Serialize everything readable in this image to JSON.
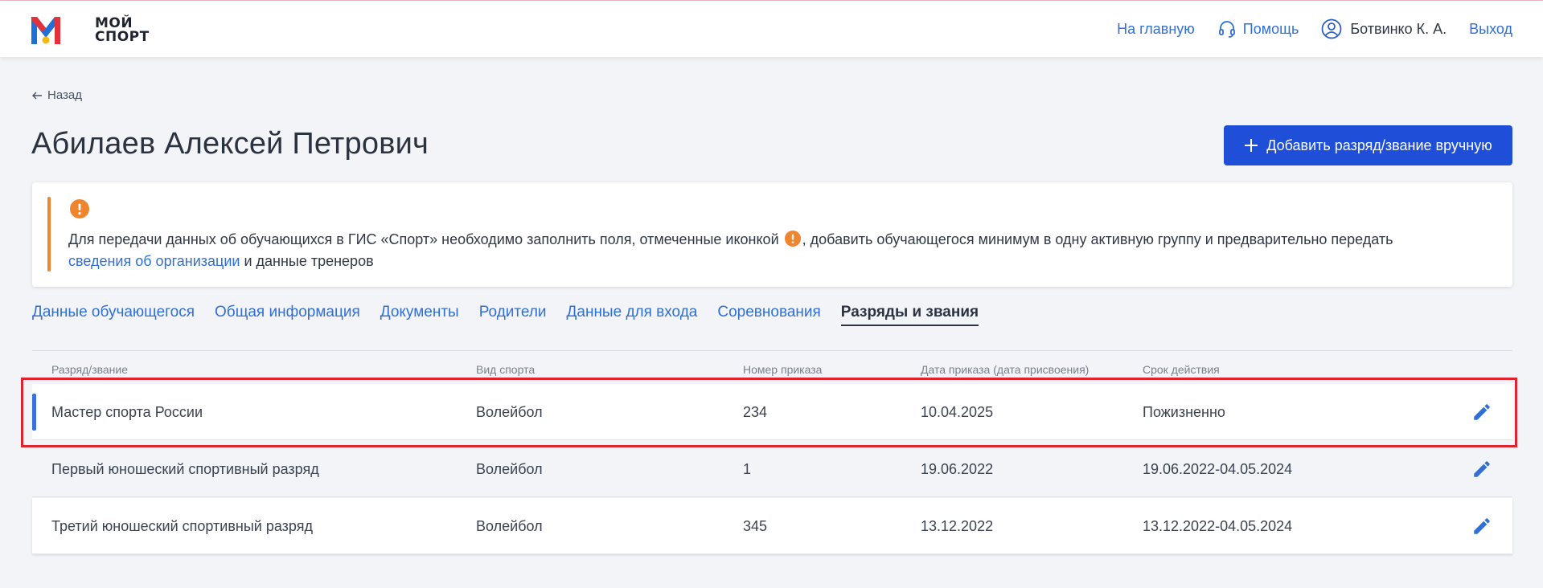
{
  "app": {
    "logo_line1": "МОЙ",
    "logo_line2": "СПОРТ",
    "brand_colors": {
      "red": "#e4323c",
      "blue": "#1f6fd6",
      "yellow": "#f2b90f"
    }
  },
  "nav": {
    "home": "На главную",
    "help": "Помощь",
    "user": "Ботвинко К. А.",
    "logout": "Выход"
  },
  "back_label": "Назад",
  "page_title": "Абилаев Алексей Петрович",
  "add_button_label": "Добавить разряд/звание вручную",
  "notice": {
    "text_before": "Для передачи данных об обучающихся в ГИС «Спорт» необходимо заполнить поля, отмеченные иконкой",
    "text_middle": ", добавить обучающегося минимум в одну активную группу и предварительно передать",
    "link": "сведения об организации",
    "text_after": " и данные тренеров",
    "accent_color": "#f0852f"
  },
  "tabs": [
    {
      "label": "Данные обучающегося",
      "active": false
    },
    {
      "label": "Общая информация",
      "active": false
    },
    {
      "label": "Документы",
      "active": false
    },
    {
      "label": "Родители",
      "active": false
    },
    {
      "label": "Данные для входа",
      "active": false
    },
    {
      "label": "Соревнования",
      "active": false
    },
    {
      "label": "Разряды и звания",
      "active": true
    }
  ],
  "table": {
    "columns": [
      "Разряд/звание",
      "Вид спорта",
      "Номер приказа",
      "Дата приказа (дата присвоения)",
      "Срок действия"
    ],
    "rows": [
      {
        "rank": "Мастер спорта России",
        "sport": "Волейбол",
        "order": "234",
        "date": "10.04.2025",
        "validity": "Пожизненно"
      },
      {
        "rank": "Первый юношеский спортивный разряд",
        "sport": "Волейбол",
        "order": "1",
        "date": "19.06.2022",
        "validity": "19.06.2022-04.05.2024"
      },
      {
        "rank": "Третий юношеский спортивный разряд",
        "sport": "Волейбол",
        "order": "345",
        "date": "13.12.2022",
        "validity": "13.12.2022-04.05.2024"
      }
    ]
  }
}
